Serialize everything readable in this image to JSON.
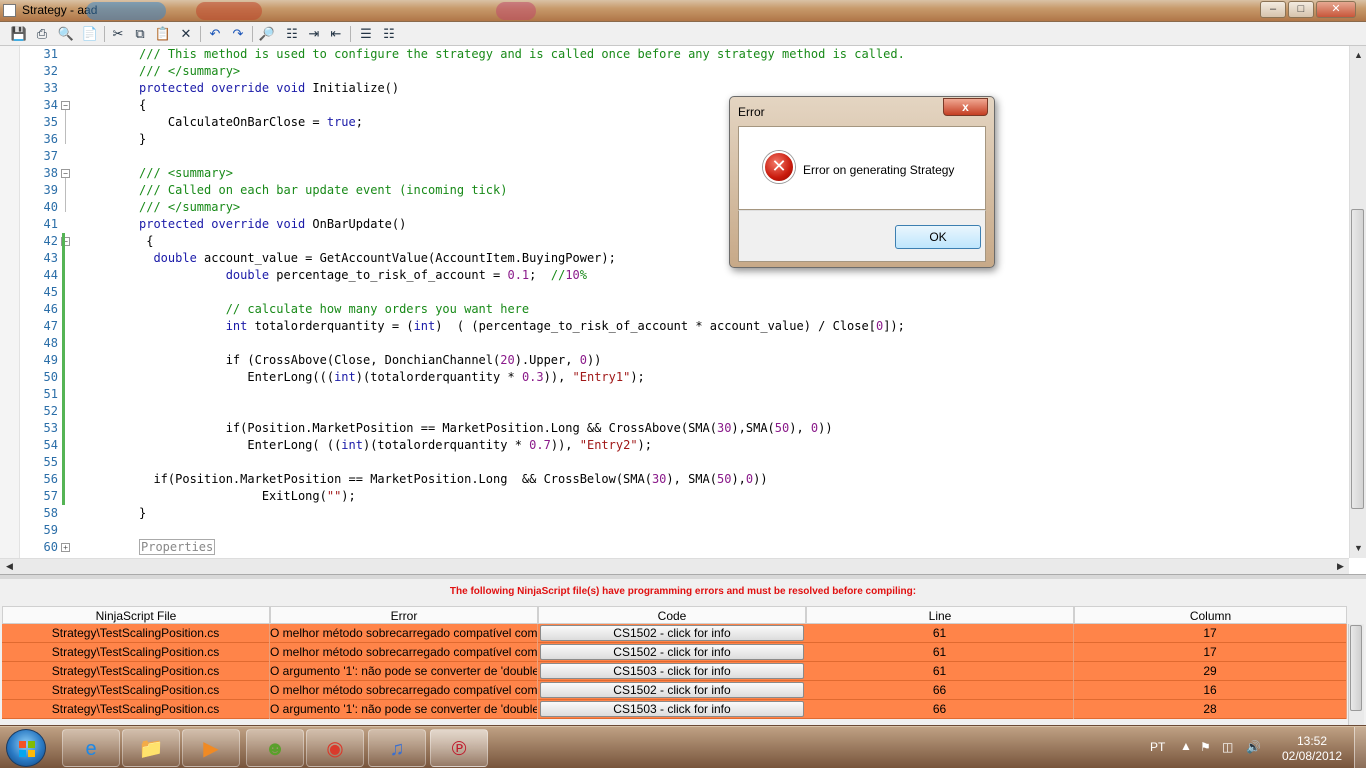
{
  "window": {
    "title": "Strategy - aad"
  },
  "toolbar": {
    "icons": [
      "save-icon",
      "print-icon",
      "print-preview-icon",
      "page-setup-icon",
      "cut-icon",
      "copy-icon",
      "paste-icon",
      "delete-icon",
      "undo-icon",
      "redo-icon",
      "find-icon",
      "replace-icon",
      "indent-icon",
      "outdent-icon",
      "comment-icon",
      "uncomment-icon"
    ]
  },
  "editor": {
    "lines": [
      {
        "n": "31",
        "code": "/// This method is used to configure the strategy and is called once before any strategy method is called.",
        "type": "comment",
        "indent": 0
      },
      {
        "n": "32",
        "code": "/// </summary>",
        "type": "comment",
        "indent": 0
      },
      {
        "n": "33",
        "code": "protected override void Initialize()",
        "type": "decl",
        "indent": 0
      },
      {
        "n": "34",
        "code": "{",
        "type": "plain",
        "indent": 0
      },
      {
        "n": "35",
        "code": "    CalculateOnBarClose = true;",
        "type": "plain",
        "indent": 0
      },
      {
        "n": "36",
        "code": "}",
        "type": "plain",
        "indent": 0
      },
      {
        "n": "37",
        "code": "",
        "type": "plain",
        "indent": 0
      },
      {
        "n": "38",
        "code": "/// <summary>",
        "type": "comment",
        "indent": 0
      },
      {
        "n": "39",
        "code": "/// Called on each bar update event (incoming tick)",
        "type": "comment",
        "indent": 0
      },
      {
        "n": "40",
        "code": "/// </summary>",
        "type": "comment",
        "indent": 0
      },
      {
        "n": "41",
        "code": "protected override void OnBarUpdate()",
        "type": "decl",
        "indent": 0
      },
      {
        "n": "42",
        "code": " {",
        "type": "plain",
        "indent": 0
      },
      {
        "n": "43",
        "code": "  double account_value = GetAccountValue(AccountItem.BuyingPower);",
        "type": "plain",
        "indent": 0
      },
      {
        "n": "44",
        "code": "            double percentage_to_risk_of_account = 0.1;  //10%",
        "type": "plain",
        "indent": 0
      },
      {
        "n": "45",
        "code": "",
        "type": "plain",
        "indent": 0
      },
      {
        "n": "46",
        "code": "            // calculate how many orders you want here",
        "type": "comment",
        "indent": 0
      },
      {
        "n": "47",
        "code": "            int totalorderquantity = (int)  ( (percentage_to_risk_of_account * account_value) / Close[0]);",
        "type": "plain",
        "indent": 0
      },
      {
        "n": "48",
        "code": "",
        "type": "plain",
        "indent": 0
      },
      {
        "n": "49",
        "code": "            if (CrossAbove(Close, DonchianChannel(20).Upper, 0))",
        "type": "plain",
        "indent": 0
      },
      {
        "n": "50",
        "code": "               EnterLong(((int)(totalorderquantity * 0.3)), \"Entry1\");",
        "type": "plain",
        "indent": 0
      },
      {
        "n": "51",
        "code": "",
        "type": "plain",
        "indent": 0
      },
      {
        "n": "52",
        "code": "",
        "type": "plain",
        "indent": 0
      },
      {
        "n": "53",
        "code": "            if(Position.MarketPosition == MarketPosition.Long && CrossAbove(SMA(30),SMA(50), 0))",
        "type": "plain",
        "indent": 0
      },
      {
        "n": "54",
        "code": "               EnterLong( ((int)(totalorderquantity * 0.7)), \"Entry2\");",
        "type": "plain",
        "indent": 0
      },
      {
        "n": "55",
        "code": "",
        "type": "plain",
        "indent": 0
      },
      {
        "n": "56",
        "code": "  if(Position.MarketPosition == MarketPosition.Long  && CrossBelow(SMA(30), SMA(50),0))",
        "type": "plain",
        "indent": 0
      },
      {
        "n": "57",
        "code": "                 ExitLong(\"\");",
        "type": "plain",
        "indent": 0
      },
      {
        "n": "58",
        "code": "}",
        "type": "plain",
        "indent": 0
      },
      {
        "n": "59",
        "code": "",
        "type": "plain",
        "indent": 0
      },
      {
        "n": "60",
        "code": "Properties",
        "type": "region",
        "indent": 0
      }
    ]
  },
  "errors": {
    "message": "The following NinjaScript file(s) have programming errors and must be resolved before compiling:",
    "columns": [
      "NinjaScript File",
      "Error",
      "Code",
      "Line",
      "Column"
    ],
    "rows": [
      {
        "file": "Strategy\\TestScalingPosition.cs",
        "error": "O melhor método sobrecarregado compatível com '",
        "code": "CS1502 - click for info",
        "line": "61",
        "column": "17"
      },
      {
        "file": "Strategy\\TestScalingPosition.cs",
        "error": "O melhor método sobrecarregado compatível com '",
        "code": "CS1502 - click for info",
        "line": "61",
        "column": "17"
      },
      {
        "file": "Strategy\\TestScalingPosition.cs",
        "error": "O argumento '1': não pode se converter de 'double'",
        "code": "CS1503 - click for info",
        "line": "61",
        "column": "29"
      },
      {
        "file": "Strategy\\TestScalingPosition.cs",
        "error": "O melhor método sobrecarregado compatível com '",
        "code": "CS1502 - click for info",
        "line": "66",
        "column": "16"
      },
      {
        "file": "Strategy\\TestScalingPosition.cs",
        "error": "O argumento '1': não pode se converter de 'double'",
        "code": "CS1503 - click for info",
        "line": "66",
        "column": "28"
      }
    ]
  },
  "dialog": {
    "title": "Error",
    "close_label": "x",
    "message": "Error on generating Strategy",
    "ok_label": "OK"
  },
  "taskbar": {
    "apps": [
      "internet-explorer",
      "windows-explorer",
      "media-player",
      "live-messenger",
      "chrome",
      "itunes",
      "ninjatrader"
    ],
    "lang": "PT",
    "time": "13:52",
    "date": "02/08/2012"
  },
  "colors": {
    "error_row": "#ff8449",
    "error_message": "#e01010",
    "comment": "#188a18",
    "keyword": "#1a1aa8"
  }
}
